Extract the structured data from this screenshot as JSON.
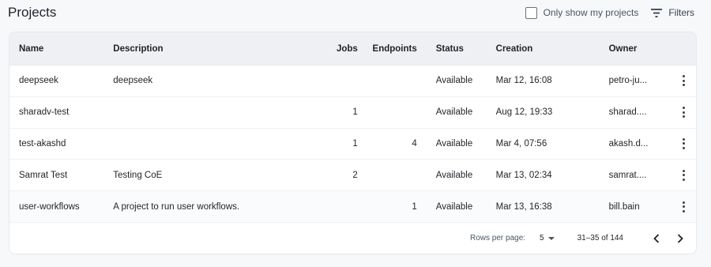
{
  "header": {
    "title": "Projects",
    "only_mine_label": "Only show my projects",
    "filters_label": "Filters"
  },
  "table": {
    "columns": {
      "name": "Name",
      "description": "Description",
      "jobs": "Jobs",
      "endpoints": "Endpoints",
      "status": "Status",
      "creation": "Creation",
      "owner": "Owner"
    },
    "rows": [
      {
        "name": "deepseek",
        "description": "deepseek",
        "jobs": "",
        "endpoints": "",
        "status": "Available",
        "creation": "Mar 12, 16:08",
        "owner": "petro-ju..."
      },
      {
        "name": "sharadv-test",
        "description": "",
        "jobs": "1",
        "endpoints": "",
        "status": "Available",
        "creation": "Aug 12, 19:33",
        "owner": "sharad...."
      },
      {
        "name": "test-akashd",
        "description": "",
        "jobs": "1",
        "endpoints": "4",
        "status": "Available",
        "creation": "Mar 4, 07:56",
        "owner": "akash.d..."
      },
      {
        "name": "Samrat Test",
        "description": "Testing CoE",
        "jobs": "2",
        "endpoints": "",
        "status": "Available",
        "creation": "Mar 13, 02:34",
        "owner": "samrat...."
      },
      {
        "name": "user-workflows",
        "description": "A project to run user workflows.",
        "jobs": "",
        "endpoints": "1",
        "status": "Available",
        "creation": "Mar 13, 16:38",
        "owner": "bill.bain"
      }
    ]
  },
  "pagination": {
    "rows_per_page_label": "Rows per page:",
    "rows_per_page_value": "5",
    "range_text": "31–35 of 144"
  },
  "icons": {
    "filter": "filter-icon",
    "row_menu": "more-vertical-icon",
    "prev": "chevron-left-icon",
    "next": "chevron-right-icon",
    "dropdown": "caret-down-icon"
  }
}
